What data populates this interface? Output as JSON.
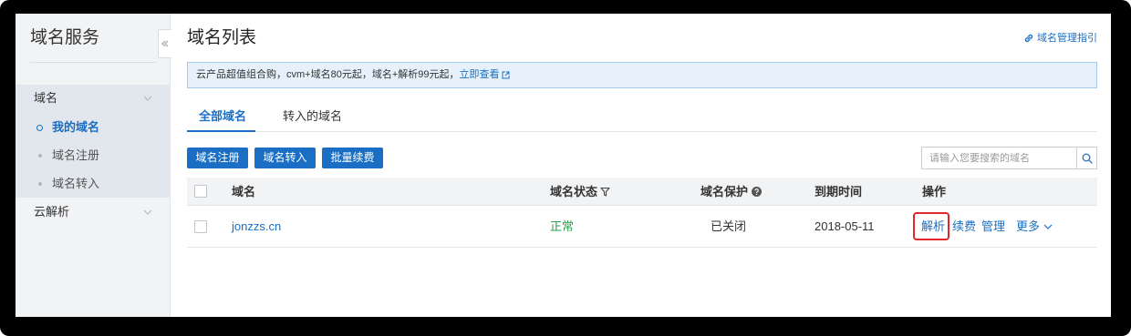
{
  "colors": {
    "accent": "#1a6fc4",
    "status_ok": "#2aa14b",
    "highlight": "#e3262a",
    "frame": "#000000"
  },
  "sidebar": {
    "title": "域名服务",
    "collapse_icon": "double-chevron-left-icon",
    "groups": [
      {
        "label": "域名",
        "icon": "chevron-down-icon",
        "expanded": true,
        "items": [
          {
            "label": "我的域名",
            "active": true
          },
          {
            "label": "域名注册",
            "active": false
          },
          {
            "label": "域名转入",
            "active": false
          }
        ]
      },
      {
        "label": "云解析",
        "icon": "chevron-down-icon",
        "expanded": false,
        "items": []
      }
    ]
  },
  "header": {
    "title": "域名列表",
    "guide_label": "域名管理指引",
    "guide_icon": "link-icon"
  },
  "banner": {
    "text": "云产品超值组合购，cvm+域名80元起，域名+解析99元起，",
    "link_label": "立即查看",
    "link_icon": "external-link-icon"
  },
  "tabs": [
    {
      "label": "全部域名",
      "active": true
    },
    {
      "label": "转入的域名",
      "active": false
    }
  ],
  "toolbar": {
    "buttons": [
      {
        "label": "域名注册"
      },
      {
        "label": "域名转入"
      },
      {
        "label": "批量续费"
      }
    ],
    "search": {
      "placeholder": "请输入您要搜索的域名",
      "icon": "search-icon"
    }
  },
  "table": {
    "columns": [
      {
        "label": "域名"
      },
      {
        "label": "域名状态",
        "icon": "filter-icon"
      },
      {
        "label": "域名保护",
        "icon": "question-circle-icon"
      },
      {
        "label": "到期时间"
      },
      {
        "label": "操作"
      }
    ],
    "rows": [
      {
        "selected": false,
        "domain": "jonzzs.cn",
        "status": "正常",
        "protection": "已关闭",
        "expiry": "2018-05-11",
        "actions": [
          {
            "label": "解析",
            "highlighted": true
          },
          {
            "label": "续费"
          },
          {
            "label": "管理"
          },
          {
            "label": "更多",
            "icon": "chevron-down-icon"
          }
        ]
      }
    ]
  }
}
